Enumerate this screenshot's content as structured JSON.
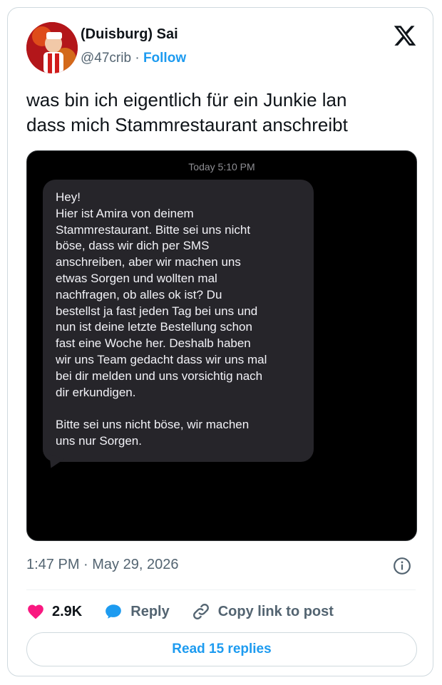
{
  "user": {
    "display_name": "(Duisburg) Sai",
    "handle": "@47crib",
    "separator": " · ",
    "follow_label": "Follow"
  },
  "tweet": {
    "text_lines": [
      "was bin ich eigentlich für ein Junkie lan",
      "dass mich Stammrestaurant anschreibt"
    ]
  },
  "media": {
    "message_time": "Today 5:10 PM",
    "message_lines": [
      "Hey!",
      "Hier ist Amira von deinem",
      "Stammrestaurant. Bitte sei uns nicht",
      "böse, dass wir dich per SMS",
      "anschreiben, aber wir machen uns",
      "etwas Sorgen und wollten mal",
      "nachfragen, ob alles ok ist? Du",
      "bestellst ja fast jeden Tag bei uns und",
      "nun ist deine letzte Bestellung schon",
      "fast eine Woche her. Deshalb haben",
      "wir uns Team gedacht dass wir uns mal",
      "bei dir melden und uns vorsichtig nach",
      "dir erkundigen.",
      "",
      "Bitte sei uns nicht böse, wir machen",
      "uns nur Sorgen."
    ]
  },
  "meta": {
    "timestamp": "1:47 PM · May 29, 2026"
  },
  "actions": {
    "likes": "2.9K",
    "reply_label": "Reply",
    "copy_link_label": "Copy link to post"
  },
  "read_replies_label": "Read 15 replies",
  "colors": {
    "accent": "#1d9bf0",
    "heart": "#f91880",
    "text": "#0f1419",
    "muted": "#536471",
    "bubble": "#26252a"
  },
  "icons": [
    "x-logo-icon",
    "info-icon",
    "heart-icon",
    "reply-bubble-icon",
    "link-icon"
  ]
}
